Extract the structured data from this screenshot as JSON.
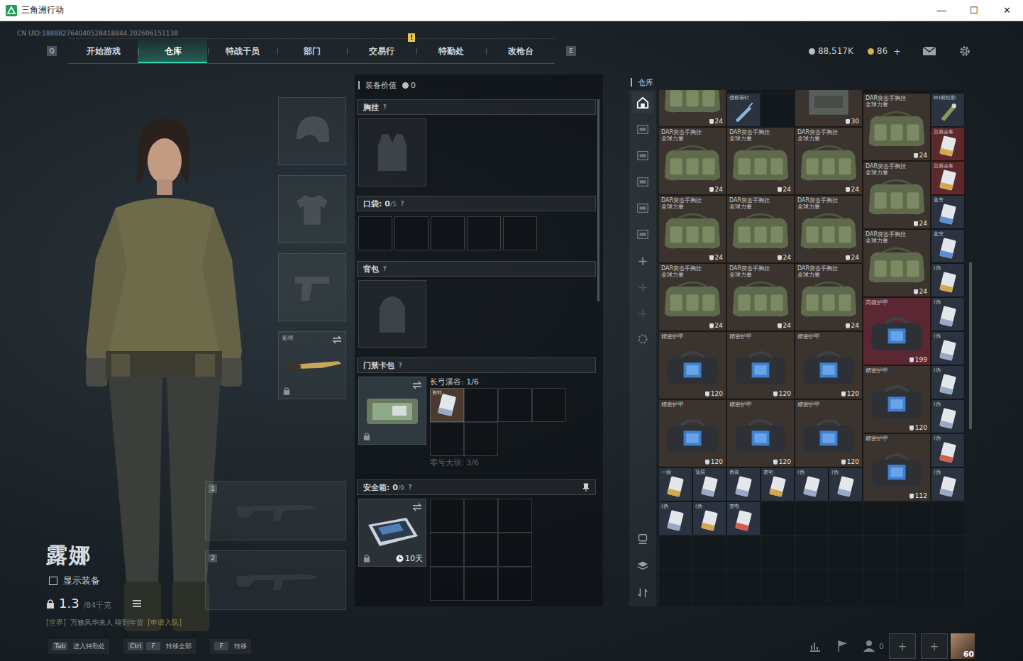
{
  "window": {
    "title": "三角洲行动",
    "controls": [
      "—",
      "☐",
      "✕"
    ]
  },
  "uid": "CN UID:188882764040528418844.202606151138",
  "nav": {
    "prev_key": "Q",
    "next_key": "E",
    "tabs": [
      {
        "label": "开始游戏",
        "selected": false,
        "badge": ""
      },
      {
        "label": "仓库",
        "selected": true,
        "badge": ""
      },
      {
        "label": "特战干员",
        "selected": false,
        "badge": ""
      },
      {
        "label": "部门",
        "selected": false,
        "badge": ""
      },
      {
        "label": "交易行",
        "selected": false,
        "badge": ""
      },
      {
        "label": "特勤处",
        "selected": false,
        "badge": "!"
      },
      {
        "label": "改枪台",
        "selected": false,
        "badge": ""
      }
    ]
  },
  "currency": [
    {
      "kind": "coin",
      "value": "88,517K",
      "add": ""
    },
    {
      "kind": "ticket",
      "value": "86",
      "add": "+"
    }
  ],
  "operator": {
    "name": "露娜",
    "show_gear": {
      "label": "显示装备",
      "checked": false
    },
    "weight": "1.3",
    "weight_max": "/84千克",
    "locked": true
  },
  "chat": {
    "channel": "[世界]",
    "text": "万籁风华来人 嗅到年货",
    "action": "[申请入队]"
  },
  "equipment": {
    "slots": [
      {
        "kind": "helmet",
        "label": "",
        "locked": false
      },
      {
        "kind": "armor",
        "label": "",
        "locked": false
      },
      {
        "kind": "pistol",
        "label": "",
        "locked": false
      },
      {
        "kind": "melee",
        "label": "影锋",
        "locked": true
      }
    ],
    "weapons": [
      "1",
      "2"
    ]
  },
  "loadout": {
    "value_label": "装备价值",
    "value": "0",
    "chest": {
      "title": "胸挂",
      "help": "?"
    },
    "pocket": {
      "title": "口袋: ",
      "count": "0",
      "cap": "/5",
      "help": "?",
      "slots": 5
    },
    "backpack": {
      "title": "背包",
      "help": "?"
    },
    "keycard": {
      "title": "门禁卡包",
      "help": "?",
      "locked": true,
      "maps": [
        {
          "label": "长弓溪谷: 1/6",
          "active": true,
          "cells": 6,
          "cards": [
            {
              "name": "资料"
            }
          ]
        },
        {
          "label": "零号大坝: 3/6",
          "active": false,
          "cells": 0,
          "cards": []
        }
      ]
    },
    "safe": {
      "title": "安全箱: ",
      "count": "0",
      "cap": "/9",
      "help": "?",
      "timer": "10天",
      "locked": true,
      "cells": 9
    }
  },
  "warehouse": {
    "title": "仓库",
    "sidebar_top": [
      {
        "kind": "safe",
        "glyph": "",
        "selected": true,
        "disabled": false
      },
      {
        "kind": "bag",
        "glyph": "",
        "selected": false,
        "disabled": false
      },
      {
        "kind": "bag",
        "glyph": "",
        "selected": false,
        "disabled": false
      },
      {
        "kind": "bag",
        "glyph": "",
        "selected": false,
        "disabled": false
      },
      {
        "kind": "bag",
        "glyph": "",
        "selected": false,
        "disabled": false
      },
      {
        "kind": "bag",
        "glyph": "",
        "selected": false,
        "disabled": false
      },
      {
        "kind": "add",
        "glyph": "+",
        "selected": false,
        "disabled": false
      },
      {
        "kind": "add",
        "glyph": "+",
        "selected": false,
        "disabled": true
      },
      {
        "kind": "add",
        "glyph": "+",
        "selected": false,
        "disabled": true
      },
      {
        "kind": "gear",
        "glyph": "",
        "selected": false,
        "disabled": false
      }
    ],
    "sidebar_bottom": [
      {
        "kind": "sort"
      },
      {
        "kind": "stack"
      },
      {
        "kind": "transfer"
      }
    ],
    "items": [
      {
        "name": "",
        "sub": "",
        "kind": "rig",
        "dur": "24",
        "color": "#3a332e",
        "accent": "",
        "col": 1,
        "row": 1
      },
      {
        "name": "信标器针",
        "sub": "",
        "kind": "syringe",
        "dur": "",
        "color": "#2b3340",
        "accent": "",
        "col": 3,
        "row": 2
      },
      {
        "name": "",
        "sub": "",
        "kind": "vest",
        "dur": "30",
        "color": "#3a332e",
        "accent": "",
        "col": 5,
        "row": 1
      },
      {
        "name": "DAR突击手胸挂",
        "sub": "全球力量",
        "kind": "rig",
        "dur": "24",
        "color": "#3a332e",
        "accent": "",
        "col": 7,
        "row": 2
      },
      {
        "name": "M1前轮胎",
        "sub": "",
        "kind": "part",
        "dur": "",
        "color": "#2b3340",
        "accent": "",
        "col": 9,
        "row": 2
      },
      {
        "name": "DAR突击手胸挂",
        "sub": "全球力量",
        "kind": "rig",
        "dur": "24",
        "color": "#3a332e",
        "accent": "",
        "col": 1,
        "row": 3
      },
      {
        "name": "DAR突击手胸挂",
        "sub": "全球力量",
        "kind": "rig",
        "dur": "24",
        "color": "#3a332e",
        "accent": "",
        "col": 3,
        "row": 3
      },
      {
        "name": "DAR突击手胸挂",
        "sub": "全球力量",
        "kind": "rig",
        "dur": "24",
        "color": "#3a332e",
        "accent": "",
        "col": 5,
        "row": 3
      },
      {
        "name": "总裁会客",
        "sub": "",
        "kind": "card",
        "dur": "",
        "color": "#5c2a2c",
        "accent": "#d4a84a",
        "col": 9,
        "row": 3
      },
      {
        "name": "DAR突击手胸挂",
        "sub": "全球力量",
        "kind": "rig",
        "dur": "24",
        "color": "#3a332e",
        "accent": "",
        "col": 7,
        "row": 4
      },
      {
        "name": "总裁会客",
        "sub": "",
        "kind": "card",
        "dur": "",
        "color": "#5c2a2c",
        "accent": "#d4a84a",
        "col": 9,
        "row": 4
      },
      {
        "name": "DAR突击手胸挂",
        "sub": "全球力量",
        "kind": "rig",
        "dur": "24",
        "color": "#3a332e",
        "accent": "",
        "col": 1,
        "row": 5
      },
      {
        "name": "DAR突击手胸挂",
        "sub": "全球力量",
        "kind": "rig",
        "dur": "24",
        "color": "#3a332e",
        "accent": "",
        "col": 3,
        "row": 5
      },
      {
        "name": "DAR突击手胸挂",
        "sub": "全球力量",
        "kind": "rig",
        "dur": "24",
        "color": "#3a332e",
        "accent": "",
        "col": 5,
        "row": 5
      },
      {
        "name": "蓝室",
        "sub": "",
        "kind": "card",
        "dur": "",
        "color": "#2b3340",
        "accent": "#5c8fd6",
        "col": 9,
        "row": 5
      },
      {
        "name": "DAR突击手胸挂",
        "sub": "全球力量",
        "kind": "rig",
        "dur": "24",
        "color": "#3a332e",
        "accent": "",
        "col": 7,
        "row": 6
      },
      {
        "name": "蓝室",
        "sub": "",
        "kind": "card",
        "dur": "",
        "color": "#2b3340",
        "accent": "#5c8fd6",
        "col": 9,
        "row": 6
      },
      {
        "name": "DAR突击手胸挂",
        "sub": "全球力量",
        "kind": "rig",
        "dur": "24",
        "color": "#3a332e",
        "accent": "",
        "col": 1,
        "row": 7
      },
      {
        "name": "DAR突击手胸挂",
        "sub": "全球力量",
        "kind": "rig",
        "dur": "24",
        "color": "#3a332e",
        "accent": "",
        "col": 3,
        "row": 7
      },
      {
        "name": "DAR突击手胸挂",
        "sub": "全球力量",
        "kind": "rig",
        "dur": "24",
        "color": "#3a332e",
        "accent": "",
        "col": 5,
        "row": 7
      },
      {
        "name": "(伪",
        "sub": "",
        "kind": "card",
        "dur": "",
        "color": "#2b3340",
        "accent": "#d4a84a",
        "col": 9,
        "row": 7
      },
      {
        "name": "高级护甲",
        "sub": "",
        "kind": "armor-advanced",
        "dur": "199",
        "color": "#5a2733",
        "accent": "",
        "col": 7,
        "row": 8
      },
      {
        "name": "(伪",
        "sub": "",
        "kind": "card",
        "dur": "",
        "color": "#2b3340",
        "accent": "#9aa8c8",
        "col": 9,
        "row": 8
      },
      {
        "name": "精密护甲",
        "sub": "",
        "kind": "armor-precise",
        "dur": "120",
        "color": "#3a332e",
        "accent": "",
        "col": 1,
        "row": 9
      },
      {
        "name": "精密护甲",
        "sub": "",
        "kind": "armor-precise",
        "dur": "120",
        "color": "#3a332e",
        "accent": "",
        "col": 3,
        "row": 9
      },
      {
        "name": "精密护甲",
        "sub": "",
        "kind": "armor-precise",
        "dur": "120",
        "color": "#3a332e",
        "accent": "",
        "col": 5,
        "row": 9
      },
      {
        "name": "(伪",
        "sub": "",
        "kind": "card",
        "dur": "",
        "color": "#2b3340",
        "accent": "#9aa8c8",
        "col": 9,
        "row": 9
      },
      {
        "name": "精密护甲",
        "sub": "",
        "kind": "armor-precise",
        "dur": "120",
        "color": "#3a332e",
        "accent": "",
        "col": 7,
        "row": 10
      },
      {
        "name": "(伪",
        "sub": "",
        "kind": "card",
        "dur": "",
        "color": "#2b3340",
        "accent": "#9aa8c8",
        "col": 9,
        "row": 10
      },
      {
        "name": "精密护甲",
        "sub": "",
        "kind": "armor-precise",
        "dur": "120",
        "color": "#3a332e",
        "accent": "",
        "col": 1,
        "row": 11
      },
      {
        "name": "精密护甲",
        "sub": "",
        "kind": "armor-precise",
        "dur": "120",
        "color": "#3a332e",
        "accent": "",
        "col": 3,
        "row": 11
      },
      {
        "name": "精密护甲",
        "sub": "",
        "kind": "armor-precise",
        "dur": "120",
        "color": "#3a332e",
        "accent": "",
        "col": 5,
        "row": 11
      },
      {
        "name": "(伪",
        "sub": "",
        "kind": "card",
        "dur": "",
        "color": "#2b3340",
        "accent": "#9aa8c8",
        "col": 9,
        "row": 11
      },
      {
        "name": "精密护甲",
        "sub": "",
        "kind": "armor-precise",
        "dur": "112",
        "color": "#3a332e",
        "accent": "",
        "col": 7,
        "row": 12
      },
      {
        "name": "(伪",
        "sub": "",
        "kind": "card",
        "dur": "",
        "color": "#2b3340",
        "accent": "#d65c4a",
        "col": 9,
        "row": 12
      },
      {
        "name": "一级",
        "sub": "",
        "kind": "card",
        "dur": "",
        "color": "#2b3340",
        "accent": "#d4a84a",
        "col": 1,
        "row": 13
      },
      {
        "name": "顶层",
        "sub": "",
        "kind": "card",
        "dur": "",
        "color": "#2b3340",
        "accent": "#9aa8c8",
        "col": 2,
        "row": 13
      },
      {
        "name": "伪装",
        "sub": "",
        "kind": "card",
        "dur": "",
        "color": "#2b3340",
        "accent": "#9aa8c8",
        "col": 3,
        "row": 13
      },
      {
        "name": "老宅",
        "sub": "",
        "kind": "card",
        "dur": "",
        "color": "#2b3340",
        "accent": "#d4a84a",
        "col": 4,
        "row": 13
      },
      {
        "name": "(伪",
        "sub": "",
        "kind": "card",
        "dur": "",
        "color": "#2b3340",
        "accent": "#9aa8c8",
        "col": 5,
        "row": 13
      },
      {
        "name": "(伪",
        "sub": "",
        "kind": "card",
        "dur": "",
        "color": "#2b3340",
        "accent": "#9aa8c8",
        "col": 6,
        "row": 13
      },
      {
        "name": "(伪",
        "sub": "",
        "kind": "card",
        "dur": "",
        "color": "#2b3340",
        "accent": "#9aa8c8",
        "col": 9,
        "row": 13
      },
      {
        "name": "(伪",
        "sub": "",
        "kind": "card",
        "dur": "",
        "color": "#2b3340",
        "accent": "#9aa8c8",
        "col": 1,
        "row": 14
      },
      {
        "name": "(伪",
        "sub": "",
        "kind": "card",
        "dur": "",
        "color": "#2b3340",
        "accent": "#d4a84a",
        "col": 2,
        "row": 14
      },
      {
        "name": "变电",
        "sub": "",
        "kind": "card",
        "dur": "",
        "color": "#2b3340",
        "accent": "#d65c4a",
        "col": 3,
        "row": 14
      }
    ]
  },
  "hints": [
    {
      "keys": [
        "Tab"
      ],
      "label": "进入特勤处"
    },
    {
      "keys": [
        "Ctrl",
        "F"
      ],
      "label": "转移全部"
    },
    {
      "keys": [
        "F"
      ],
      "label": "转移"
    }
  ],
  "footer": {
    "friends": "0",
    "slots": [
      "+",
      "+"
    ],
    "level": "60"
  }
}
